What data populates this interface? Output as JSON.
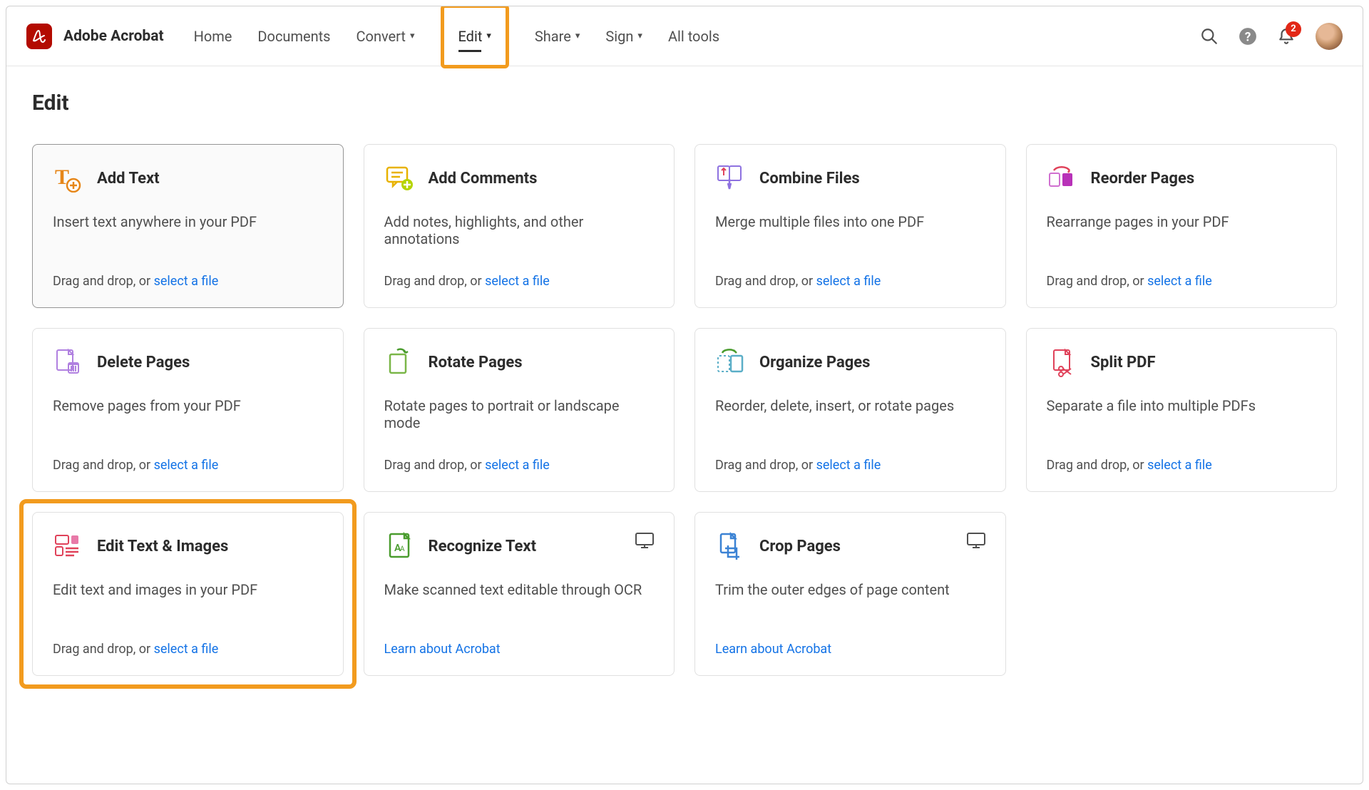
{
  "app": {
    "title": "Adobe Acrobat"
  },
  "nav": {
    "home": "Home",
    "documents": "Documents",
    "convert": "Convert",
    "edit": "Edit",
    "share": "Share",
    "sign": "Sign",
    "alltools": "All tools"
  },
  "notifications": {
    "count": "2"
  },
  "page": {
    "title": "Edit"
  },
  "common": {
    "drag": "Drag and drop, or ",
    "select": "select a file",
    "learn": "Learn about Acrobat"
  },
  "cards": [
    {
      "title": "Add Text",
      "desc": "Insert text anywhere in your PDF"
    },
    {
      "title": "Add Comments",
      "desc": "Add notes, highlights, and other annotations"
    },
    {
      "title": "Combine Files",
      "desc": "Merge multiple files into one PDF"
    },
    {
      "title": "Reorder Pages",
      "desc": "Rearrange pages in your PDF"
    },
    {
      "title": "Delete Pages",
      "desc": "Remove pages from your PDF"
    },
    {
      "title": "Rotate Pages",
      "desc": "Rotate pages to portrait or landscape mode"
    },
    {
      "title": "Organize Pages",
      "desc": "Reorder, delete, insert, or rotate pages"
    },
    {
      "title": "Split PDF",
      "desc": "Separate a file into multiple PDFs"
    },
    {
      "title": "Edit Text & Images",
      "desc": "Edit text and images in your PDF"
    },
    {
      "title": "Recognize Text",
      "desc": "Make scanned text editable through OCR"
    },
    {
      "title": "Crop Pages",
      "desc": "Trim the outer edges of page content"
    }
  ]
}
